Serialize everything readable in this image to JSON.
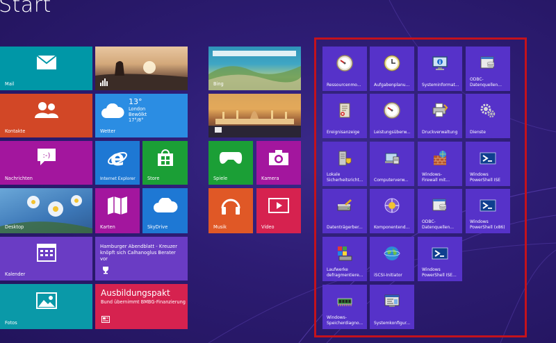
{
  "screen": {
    "title": "Start"
  },
  "tiles": {
    "mail": "Mail",
    "kontakte": "Kontakte",
    "nachrichten": "Nachrichten",
    "desktop": "Desktop",
    "kalender": "Kalender",
    "fotos": "Fotos",
    "wetter": "Wetter",
    "weather_temp": "13°",
    "weather_city": "London",
    "weather_cond": "Bewölkt",
    "weather_range": "17°/8°",
    "ie": "Internet Explorer",
    "store": "Store",
    "karten": "Karten",
    "skydrive": "SkyDrive",
    "news_text": "Hamburger Abendblatt - Kreuzer knöpft sich Calhanoglus Berater vor",
    "sport_title": "Ausbildungspakt",
    "sport_text": "Bund übernimmt BMBG-Finanzierung",
    "bing": "Bing",
    "spiele": "Spiele",
    "kamera": "Kamera",
    "musik": "Musik",
    "video": "Video"
  },
  "admin_tools": [
    {
      "label": "Ressourcenmo...",
      "icon": "gauge-icon"
    },
    {
      "label": "Aufgabenplanu...",
      "icon": "clock-icon"
    },
    {
      "label": "Systeminformat...",
      "icon": "monitor-info-icon"
    },
    {
      "label": "ODBC-\nDatenquellen...",
      "icon": "odbc-icon"
    },
    {
      "label": "Ereignisanzeige",
      "icon": "event-log-icon"
    },
    {
      "label": "Leistungsüberw...",
      "icon": "gauge-icon"
    },
    {
      "label": "Druckverwaltung",
      "icon": "printer-icon"
    },
    {
      "label": "Dienste",
      "icon": "gears-icon"
    },
    {
      "label": "Lokale\nSicherheitsricht...",
      "icon": "server-shield-icon"
    },
    {
      "label": "Computerverw...",
      "icon": "computer-management-icon"
    },
    {
      "label": "Windows-\nFirewall mit...",
      "icon": "firewall-icon"
    },
    {
      "label": "Windows\nPowerShell ISE",
      "icon": "powershell-icon"
    },
    {
      "label": "Datenträgerber...",
      "icon": "disk-cleanup-icon"
    },
    {
      "label": "Komponentend...",
      "icon": "component-services-icon"
    },
    {
      "label": "ODBC-\nDatenquellen...",
      "icon": "odbc-icon"
    },
    {
      "label": "Windows\nPowerShell (x86)",
      "icon": "powershell-icon"
    },
    {
      "label": "Laufwerke\ndefragmentiere...",
      "icon": "defrag-icon"
    },
    {
      "label": "iSCSI-Initiator",
      "icon": "globe-icon"
    },
    {
      "label": "Windows\nPowerShell ISE...",
      "icon": "powershell-icon"
    },
    {
      "label": "Windows-\nSpeicherdiagno...",
      "icon": "memory-chip-icon"
    },
    {
      "label": "Systemkonfigur...",
      "icon": "system-config-icon"
    }
  ],
  "colors": {
    "background": "#2d1c73",
    "admin_tile": "#5632c9",
    "highlight_border": "#c4121c"
  }
}
